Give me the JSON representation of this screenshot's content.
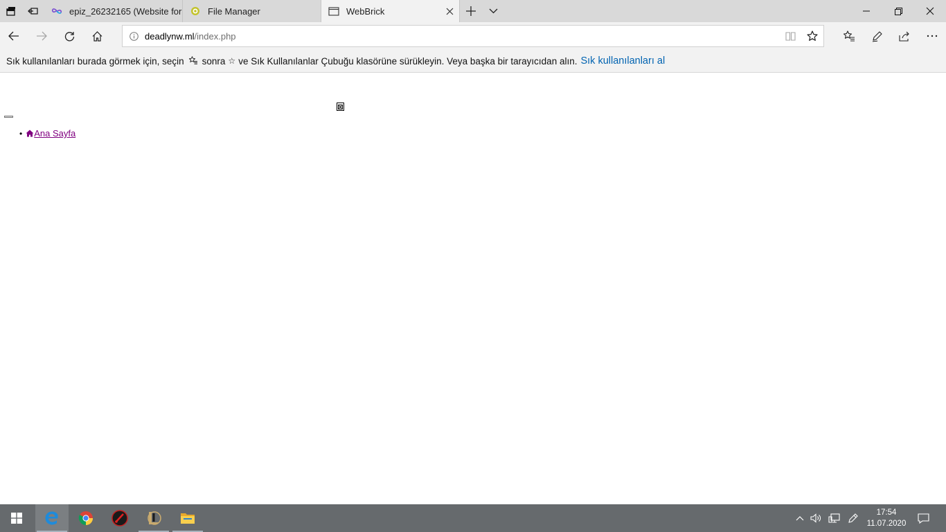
{
  "browser": {
    "tabs": [
      {
        "label": "epiz_26232165 (Website for",
        "favicon": "infinity-icon",
        "active": false
      },
      {
        "label": "File Manager",
        "favicon": "file-manager-icon",
        "active": false
      },
      {
        "label": "WebBrick",
        "favicon": "page-icon",
        "active": true
      }
    ],
    "address": {
      "domain": "deadlynw.ml",
      "path": "/index.php"
    }
  },
  "favorites_bar": {
    "text_before": "Sık kullanılanları burada görmek için, seçin",
    "text_middle": "sonra",
    "text_after": "ve Sık Kullanılanlar Çubuğu klasörüne sürükleyin. Veya başka bir tarayıcıdan alın.",
    "link": "Sık kullanılanları al",
    "star_glyph": "☆"
  },
  "page": {
    "nav_items": [
      {
        "label": " Ana Sayfa",
        "icon": "home-icon"
      }
    ],
    "link_color": "#800080"
  },
  "taskbar": {
    "time": "17:54",
    "date": "11.07.2020"
  },
  "colors": {
    "tabbar_bg": "#d9d9d9",
    "toolbar_bg": "#f2f2f2",
    "accent_link": "#0063b1",
    "taskbar_bg": "#666a6d"
  }
}
